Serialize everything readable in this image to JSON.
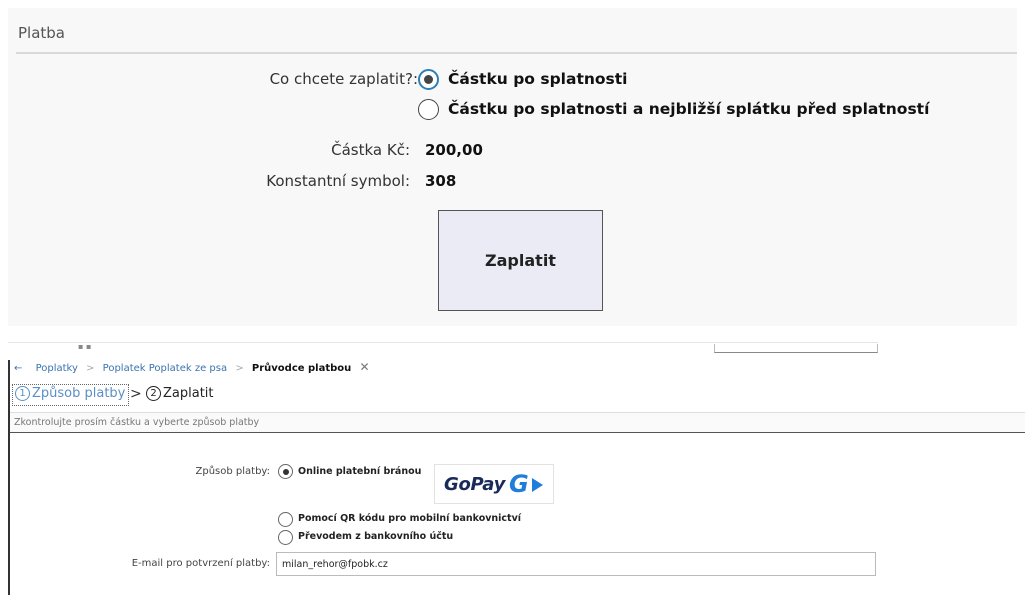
{
  "top": {
    "section_title": "Platba",
    "question_label": "Co chcete zaplatit?:",
    "options": [
      {
        "label": "Částku po splatnosti",
        "selected": true
      },
      {
        "label": "Částku po splatnosti a nejbližší splátku před splatností",
        "selected": false
      }
    ],
    "amount_label": "Částka Kč:",
    "amount_value": "200,00",
    "symbol_label": "Konstantní symbol:",
    "symbol_value": "308",
    "pay_button": "Zaplatit"
  },
  "bottom": {
    "breadcrumb": {
      "back_icon": "arrow-left-icon",
      "items": [
        "Poplatky",
        "Poplatek Poplatek ze psa"
      ],
      "current": "Průvodce platbou",
      "close_icon": "close-icon"
    },
    "steps": [
      {
        "number": "1",
        "label": "Způsob platby",
        "active": true
      },
      {
        "number": "2",
        "label": "Zaplatit",
        "active": false
      }
    ],
    "info": "Zkontrolujte prosím částku a vyberte způsob platby",
    "method_label": "Způsob platby:",
    "methods": [
      {
        "label": "Online platební bránou",
        "selected": true
      },
      {
        "label": "Pomocí QR kódu pro mobilní bankovnictví",
        "selected": false
      },
      {
        "label": "Převodem z bankovního účtu",
        "selected": false
      }
    ],
    "gopay_logo": "GoPay",
    "email_label": "E-mail pro potvrzení platby:",
    "email_value": "milan_rehor@fpobk.cz",
    "colors": {
      "link": "#3b74b0",
      "step_active": "#5b8fc7",
      "gopay_blue": "#1f7ddc",
      "gopay_navy": "#1a2b5a"
    }
  }
}
